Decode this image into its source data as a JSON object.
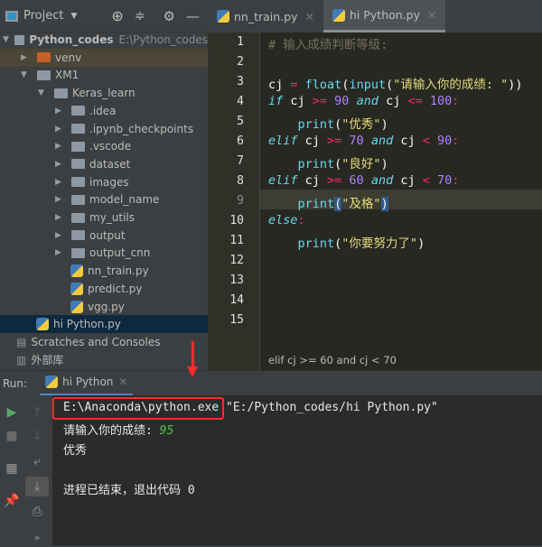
{
  "project_panel": {
    "title": "Project",
    "tree": [
      {
        "label": "Python_codes",
        "hint": "E:\\Python_codes",
        "kind": "root",
        "depth": 0,
        "expanded": true
      },
      {
        "label": "venv",
        "kind": "folder-excluded",
        "depth": 1,
        "expanded": false
      },
      {
        "label": "XM1",
        "kind": "folder",
        "depth": 1,
        "expanded": true
      },
      {
        "label": "Keras_learn",
        "kind": "folder",
        "depth": 2,
        "expanded": true
      },
      {
        "label": ".idea",
        "kind": "folder",
        "depth": 3
      },
      {
        "label": ".ipynb_checkpoints",
        "kind": "folder",
        "depth": 3
      },
      {
        "label": ".vscode",
        "kind": "folder",
        "depth": 3
      },
      {
        "label": "dataset",
        "kind": "folder",
        "depth": 3
      },
      {
        "label": "images",
        "kind": "folder",
        "depth": 3
      },
      {
        "label": "model_name",
        "kind": "folder",
        "depth": 3
      },
      {
        "label": "my_utils",
        "kind": "folder",
        "depth": 3
      },
      {
        "label": "output",
        "kind": "folder",
        "depth": 3
      },
      {
        "label": "output_cnn",
        "kind": "folder",
        "depth": 3
      },
      {
        "label": "nn_train.py",
        "kind": "py",
        "depth": 4
      },
      {
        "label": "predict.py",
        "kind": "py",
        "depth": 4
      },
      {
        "label": "vgg.py",
        "kind": "py",
        "depth": 4
      },
      {
        "label": "hi Python.py",
        "kind": "py",
        "depth": 2,
        "selected": true
      },
      {
        "label": "Scratches and Consoles",
        "kind": "scratch",
        "depth": 0
      },
      {
        "label": "外部库",
        "kind": "lib",
        "depth": 0
      }
    ]
  },
  "tabs": [
    {
      "label": "nn_train.py",
      "active": false
    },
    {
      "label": "hi Python.py",
      "active": true
    }
  ],
  "code_lines": [
    [
      [
        "cm",
        "# 输入成绩判断等级:"
      ]
    ],
    [],
    [
      [
        "",
        "cj "
      ],
      [
        "op",
        "="
      ],
      [
        "fn",
        " float"
      ],
      [
        "",
        "("
      ],
      [
        "fn",
        "input"
      ],
      [
        "",
        "("
      ],
      [
        "str",
        "\"请输入你的成绩: \""
      ],
      [
        "",
        "))"
      ]
    ],
    [
      [
        "kw",
        "if"
      ],
      [
        "",
        " cj "
      ],
      [
        "op",
        ">="
      ],
      [
        "num",
        " 90 "
      ],
      [
        "kw",
        "and"
      ],
      [
        "",
        " cj "
      ],
      [
        "op",
        "<="
      ],
      [
        "num",
        " 100"
      ],
      [
        "op",
        ":"
      ]
    ],
    [
      [
        "",
        "    "
      ],
      [
        "fn",
        "print"
      ],
      [
        "",
        "("
      ],
      [
        "str",
        "\"优秀\""
      ],
      [
        "",
        ")"
      ]
    ],
    [
      [
        "kw",
        "elif"
      ],
      [
        "",
        " cj "
      ],
      [
        "op",
        ">="
      ],
      [
        "num",
        " 70 "
      ],
      [
        "kw",
        "and"
      ],
      [
        "",
        " cj "
      ],
      [
        "op",
        "<"
      ],
      [
        "num",
        " 90"
      ],
      [
        "op",
        ":"
      ]
    ],
    [
      [
        "",
        "    "
      ],
      [
        "fn",
        "print"
      ],
      [
        "",
        "("
      ],
      [
        "str",
        "\"良好\""
      ],
      [
        "",
        ")"
      ]
    ],
    [
      [
        "kw",
        "elif"
      ],
      [
        "",
        " cj "
      ],
      [
        "op",
        ">="
      ],
      [
        "num",
        " 60 "
      ],
      [
        "kw",
        "and"
      ],
      [
        "",
        " cj "
      ],
      [
        "op",
        "<"
      ],
      [
        "num",
        " 70"
      ],
      [
        "op",
        ":"
      ]
    ],
    [
      [
        "",
        "    "
      ],
      [
        "fn",
        "print"
      ],
      [
        "br",
        "("
      ],
      [
        "str",
        "\"及格\""
      ],
      [
        "br",
        ")"
      ]
    ],
    [
      [
        "kw",
        "else"
      ],
      [
        "op",
        ":"
      ]
    ],
    [
      [
        "",
        "    "
      ],
      [
        "fn",
        "print"
      ],
      [
        "",
        "("
      ],
      [
        "str",
        "\"你要努力了\""
      ],
      [
        "",
        ")"
      ]
    ],
    [],
    [],
    [],
    []
  ],
  "breadcrumb": "elif cj >= 60 and cj < 70",
  "run": {
    "label": "Run:",
    "tab": "hi Python"
  },
  "console": {
    "exe": "E:\\Anaconda\\python.exe",
    "script": " \"E:/Python_codes/hi Python.py\"",
    "prompt": "请输入你的成绩: ",
    "input": "95",
    "output": "优秀",
    "exit": "进程已结束，退出代码 0"
  },
  "colors": {
    "annotation": "#ff2a2a",
    "input": "#59c152"
  }
}
